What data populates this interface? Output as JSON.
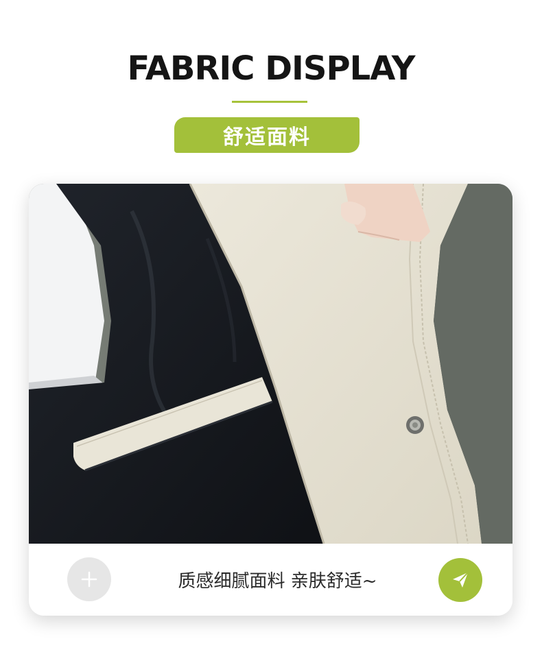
{
  "header": {
    "title": "FABRIC DISPLAY",
    "tag_label": "舒适面料"
  },
  "card": {
    "image_description": "product-photo-jacket-inner-lining",
    "caption": "质感细腻面料 亲肤舒适~",
    "add_icon": "plus-icon",
    "send_icon": "send-icon"
  },
  "colors": {
    "accent": "#a3c03a",
    "title_text": "#151515",
    "caption_text": "#2a2a2a",
    "add_button_bg": "#e6e6e6",
    "fabric_beige": "#e6e1d2",
    "lining_black": "#15181e"
  }
}
